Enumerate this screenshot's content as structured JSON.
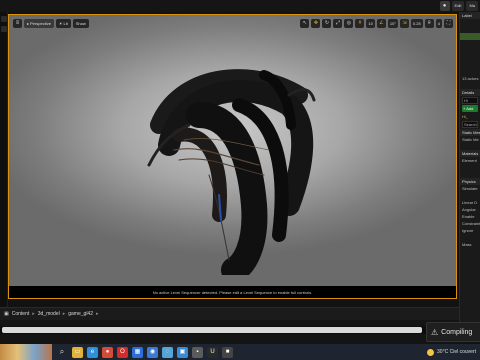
{
  "topbar": {
    "chip1": "Edit",
    "chip2": "Ma"
  },
  "viewport": {
    "perspective_label": "Perspective",
    "lit_label": "Lit",
    "show_label": "Show",
    "grid_value": "10",
    "angle_value": "10°",
    "scale_value": "0.25",
    "cam_speed": "4",
    "message": "No active Level Sequencer detected. Please edit a Level Sequence to enable full controls."
  },
  "rightpanel": {
    "rows": [
      "Label",
      "",
      "",
      "",
      "",
      "",
      "",
      "",
      "",
      "13 actors",
      "",
      "Details",
      "Hi",
      "",
      "+ Add",
      "",
      "Hi_",
      "",
      "Search",
      "",
      "Static Mesh",
      "",
      "Static Me",
      "",
      "Materials",
      "",
      "Element",
      "",
      "",
      "",
      "Physics",
      "Simulate",
      "",
      "Linear D",
      "Angular",
      "Enable",
      "Constraints",
      "Ignore",
      "",
      "Mass"
    ]
  },
  "contentbrowser": {
    "crumbs": [
      "Content",
      "3d_model",
      "game_gl42"
    ]
  },
  "toast": {
    "text": "Compiling"
  },
  "taskbar": {
    "weather": "30°C  Ciel couvert",
    "apps": [
      {
        "icon": "file-explorer-icon",
        "glyph": "▭",
        "color": "#e0b33a"
      },
      {
        "icon": "edge-icon",
        "glyph": "e",
        "color": "#2f8fd8"
      },
      {
        "icon": "chrome-icon",
        "glyph": "●",
        "color": "#d44b3a"
      },
      {
        "icon": "opera-icon",
        "glyph": "O",
        "color": "#d22b2b"
      },
      {
        "icon": "store-icon",
        "glyph": "▦",
        "color": "#2b6fd6"
      },
      {
        "icon": "app-icon",
        "glyph": "◉",
        "color": "#3a7bd5"
      },
      {
        "icon": "app2-icon",
        "glyph": "◌",
        "color": "#55a4d8"
      },
      {
        "icon": "photos-icon",
        "glyph": "▣",
        "color": "#3a8ad6"
      },
      {
        "icon": "app3-icon",
        "glyph": "▪",
        "color": "#5b5b5b"
      },
      {
        "icon": "unreal-icon",
        "glyph": "U",
        "color": "#2a2a2a"
      },
      {
        "icon": "app4-icon",
        "glyph": "■",
        "color": "#444"
      }
    ]
  }
}
